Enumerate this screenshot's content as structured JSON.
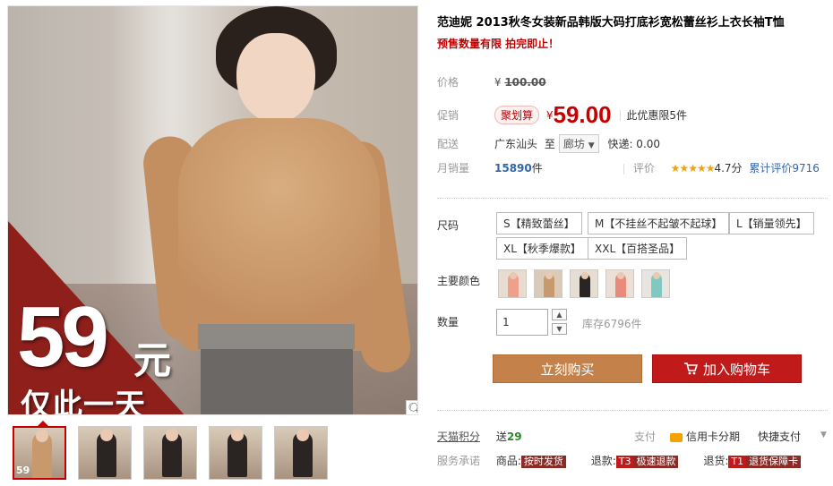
{
  "gallery": {
    "promo_price": "59",
    "promo_unit": "元",
    "promo_text": "仅此一天",
    "thumb_badge": "59"
  },
  "product": {
    "title": "范迪妮 2013秋冬女装新品韩版大码打底衫宽松蕾丝衫上衣长袖T恤",
    "subtitle": "预售数量有限 拍完即止！"
  },
  "price": {
    "label": "价格",
    "currency": "¥",
    "original": "100.00"
  },
  "promo": {
    "label": "促销",
    "badge": "聚划算",
    "currency": "¥",
    "price": "59.00",
    "limit": "此优惠限5件"
  },
  "shipping": {
    "label": "配送",
    "from": "广东汕头",
    "to_word": "至",
    "destination": "廊坊",
    "express": "快递: 0.00"
  },
  "sales": {
    "label": "月销量",
    "count": "15890",
    "unit": "件",
    "rating_label": "评价",
    "stars": "★★★★★",
    "rating": "4.7分",
    "reviews": "累计评价9716"
  },
  "size": {
    "label": "尺码",
    "options": [
      "S【精致蕾丝】",
      "M【不挂丝不起皱不起球】",
      "L【销量领先】",
      "XL【秋季爆款】",
      "XXL【百搭圣品】"
    ]
  },
  "color": {
    "label": "主要颜色",
    "swatch_colors": [
      "#f0a08a",
      "#c8996d",
      "#2a2422",
      "#e98a7a",
      "#7fc9c2"
    ]
  },
  "quantity": {
    "label": "数量",
    "value": "1",
    "stock": "库存6796件"
  },
  "actions": {
    "buy": "立刻购买",
    "cart": "加入购物车"
  },
  "points": {
    "label": "天猫积分",
    "send": "送",
    "value": "29",
    "pay_label": "支付",
    "card_installment": "信用卡分期",
    "quick_pay": "快捷支付"
  },
  "service": {
    "label": "服务承诺",
    "goods_label": "商品:",
    "goods_tag": "按时发货",
    "refund_label": "退款:",
    "refund_code": "T3",
    "refund_tag": "极速退款",
    "return_label": "退货:",
    "return_code": "T1",
    "return_tag": "退货保障卡"
  }
}
